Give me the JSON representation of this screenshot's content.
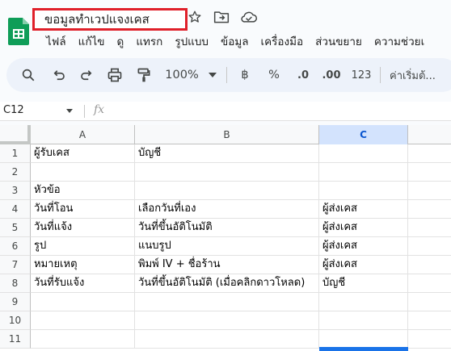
{
  "doc": {
    "title": "ขอมูลทำเวปแจงเคส"
  },
  "menu": [
    "ไฟล์",
    "แก้ไข",
    "ดู",
    "แทรก",
    "รูปแบบ",
    "ข้อมูล",
    "เครื่องมือ",
    "ส่วนขยาย",
    "ความช่วยเ"
  ],
  "toolbar": {
    "zoom": "100%",
    "currency": "฿",
    "percent": "%",
    "dec_decrease": ".0",
    "dec_increase": ".00",
    "number_format": "123",
    "default_format": "ค่าเริ่มต้..."
  },
  "formula_bar": {
    "cell_ref": "C12",
    "fx": "fx",
    "content": ""
  },
  "sheet": {
    "columns": [
      "A",
      "B",
      "C"
    ],
    "selected_column": "C",
    "rows": [
      {
        "n": "1",
        "cells": [
          "ผู้รับเคส",
          "บัญชี",
          ""
        ]
      },
      {
        "n": "2",
        "cells": [
          "",
          "",
          ""
        ]
      },
      {
        "n": "3",
        "cells": [
          "หัวข้อ",
          "",
          ""
        ]
      },
      {
        "n": "4",
        "cells": [
          "วันที่โอน",
          "เลือกวันที่เอง",
          "ผู้ส่งเคส"
        ]
      },
      {
        "n": "5",
        "cells": [
          "วันที่แจ้ง",
          "วันที่ขึ้นอัติโนมัติ",
          "ผู้ส่งเคส"
        ]
      },
      {
        "n": "6",
        "cells": [
          "รูป",
          "แนบรูป",
          "ผู้ส่งเคส"
        ]
      },
      {
        "n": "7",
        "cells": [
          "หมายเหตุ",
          "พิมพ์ IV + ชื่อร้าน",
          "ผู้ส่งเคส"
        ]
      },
      {
        "n": "8",
        "cells": [
          "วันที่รับแจ้ง",
          "วันที่ขึ้นอัติโนมัติ (เมื่อคลิกดาวโหลด)",
          "บัญชี"
        ]
      },
      {
        "n": "9",
        "cells": [
          "",
          "",
          ""
        ]
      },
      {
        "n": "10",
        "cells": [
          "",
          "",
          ""
        ]
      },
      {
        "n": "11",
        "cells": [
          "",
          "",
          ""
        ]
      }
    ]
  },
  "colors": {
    "accent": "#1a73e8",
    "highlight_box": "#e0202a",
    "logo": "#0f9d58",
    "toolbar_bg": "#edf2fa",
    "selected_header": "#d3e3fd"
  },
  "icons": [
    "sheets-logo-icon",
    "star-icon",
    "move-to-folder-icon",
    "cloud-status-icon",
    "search-icon",
    "undo-icon",
    "redo-icon",
    "print-icon",
    "paint-format-icon",
    "dropdown-arrow-icon"
  ]
}
